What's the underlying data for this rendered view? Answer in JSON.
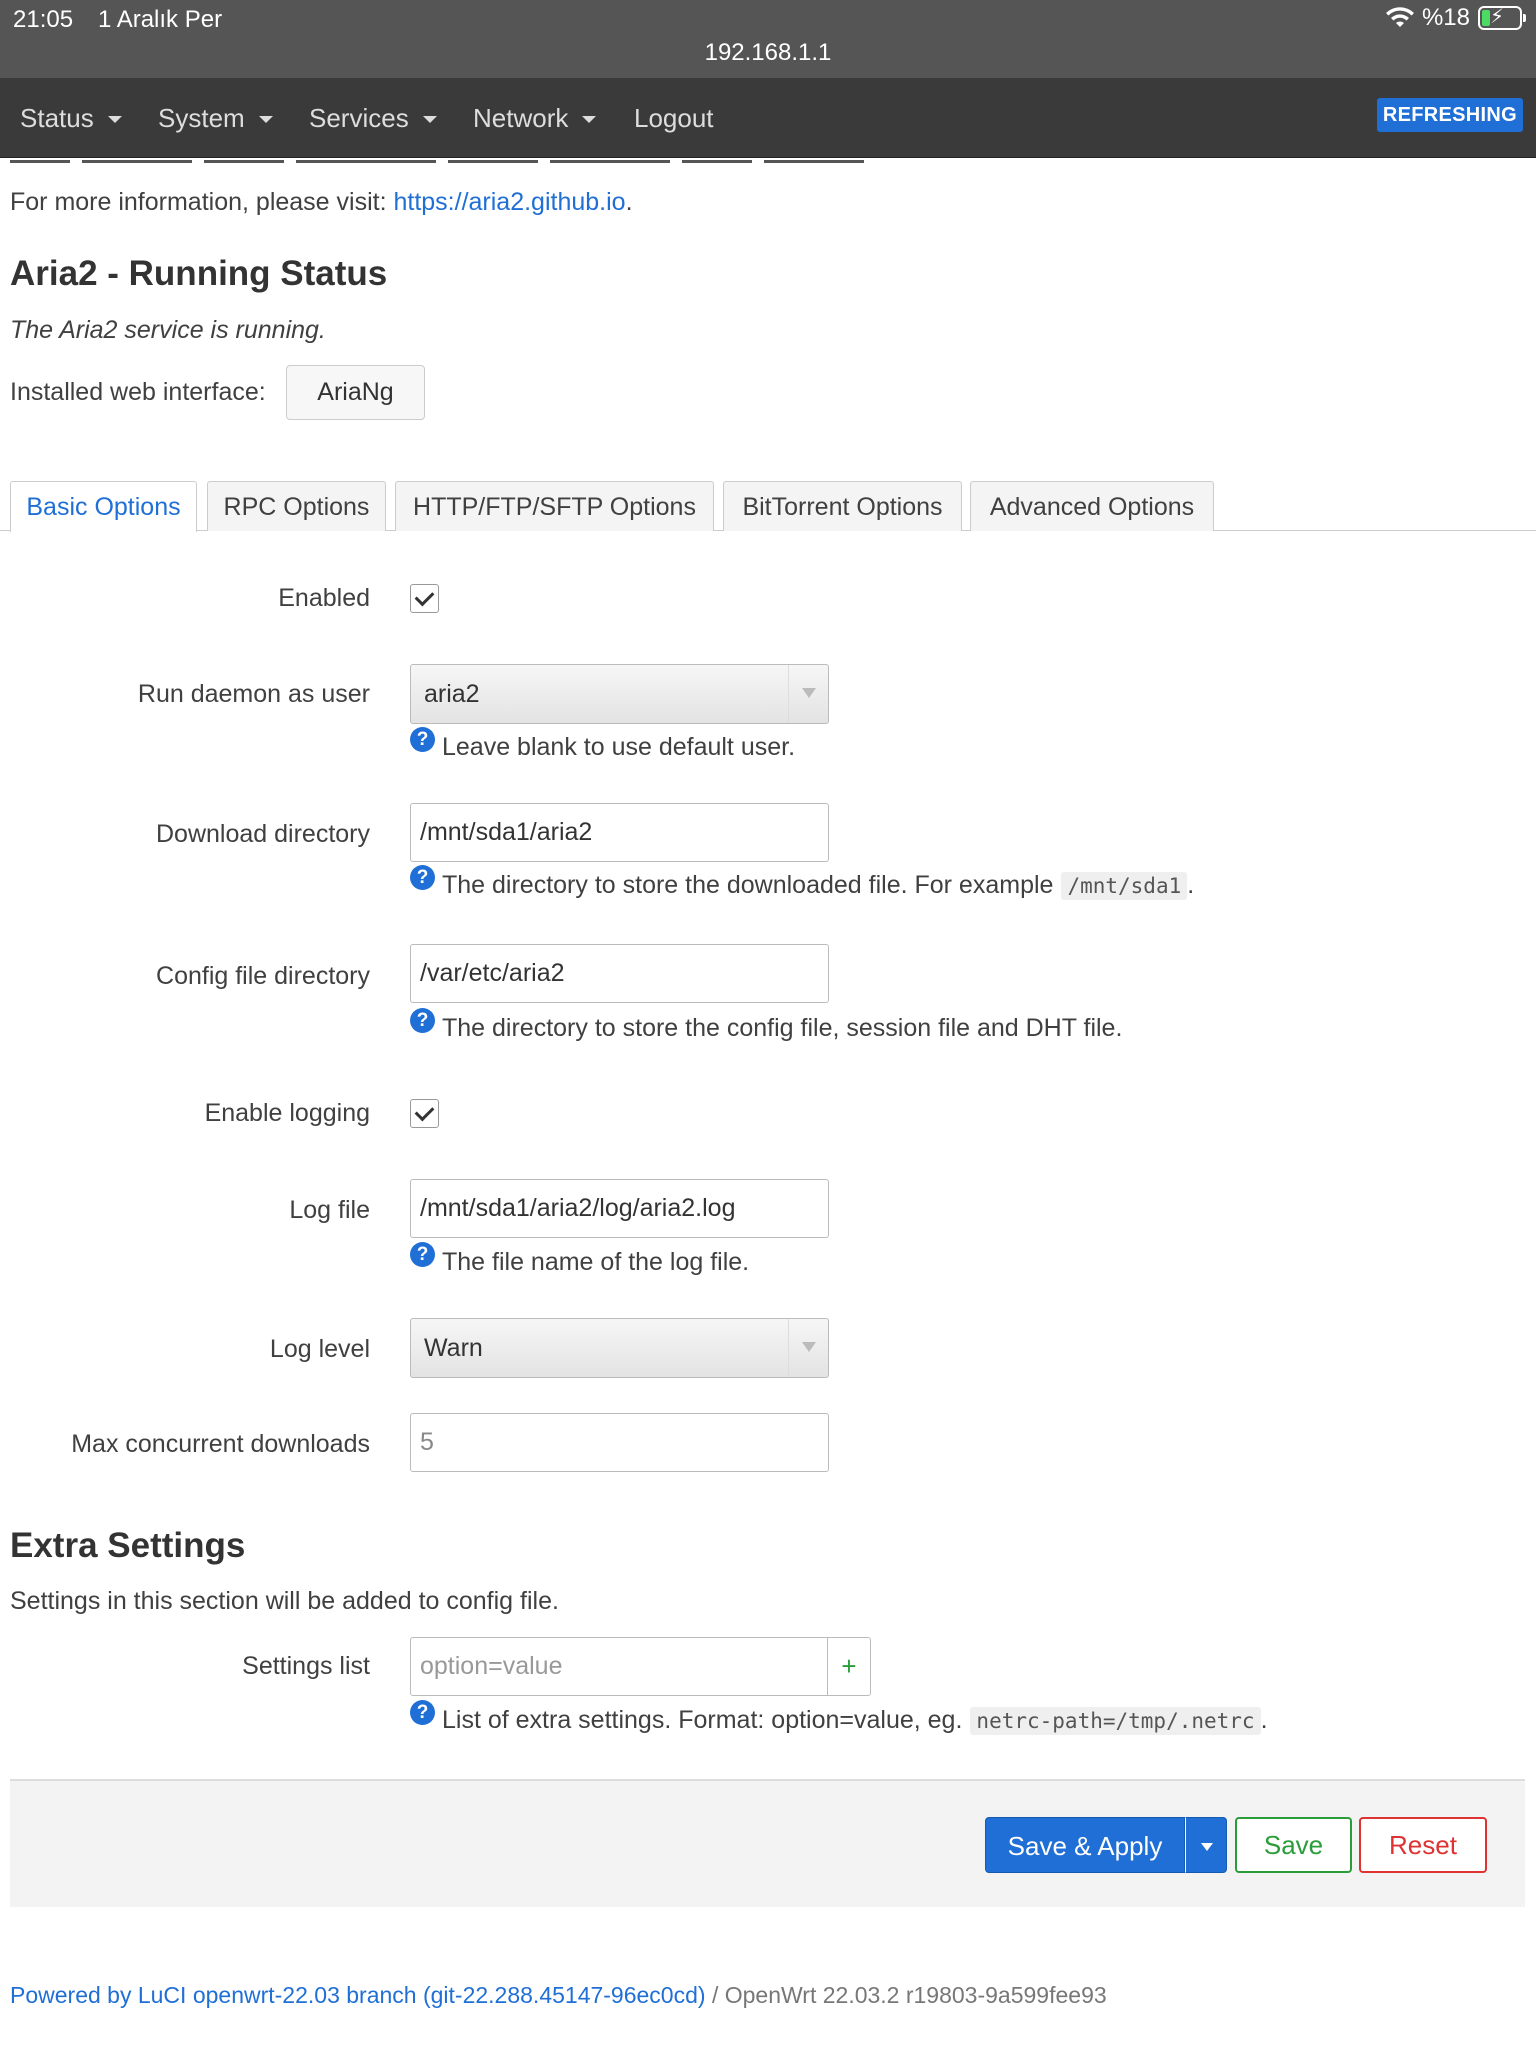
{
  "statusbar": {
    "time": "21:05",
    "date": "1 Aralık Per",
    "url": "192.168.1.1",
    "battery": "%18"
  },
  "nav": {
    "items": [
      "Status",
      "System",
      "Services",
      "Network",
      "Logout"
    ],
    "refreshing": "REFRESHING"
  },
  "intro": {
    "more_info": "For more information, please visit:",
    "link": "https://aria2.github.io",
    "period": "."
  },
  "status": {
    "title": "Aria2 - Running Status",
    "running": "The Aria2 service is running.",
    "web_label": "Installed web interface:",
    "web_button": "AriaNg"
  },
  "tabs": [
    "Basic Options",
    "RPC Options",
    "HTTP/FTP/SFTP Options",
    "BitTorrent Options",
    "Advanced Options"
  ],
  "form": {
    "enabled": {
      "label": "Enabled",
      "checked": true
    },
    "user": {
      "label": "Run daemon as user",
      "value": "aria2",
      "help": "Leave blank to use default user."
    },
    "download_dir": {
      "label": "Download directory",
      "value": "/mnt/sda1/aria2",
      "help": "The directory to store the downloaded file. For example",
      "code": "/mnt/sda1",
      "tail": "."
    },
    "config_dir": {
      "label": "Config file directory",
      "value": "/var/etc/aria2",
      "help": "The directory to store the config file, session file and DHT file."
    },
    "logging": {
      "label": "Enable logging",
      "checked": true
    },
    "log_file": {
      "label": "Log file",
      "value": "/mnt/sda1/aria2/log/aria2.log",
      "help": "The file name of the log file."
    },
    "log_level": {
      "label": "Log level",
      "value": "Warn"
    },
    "max_downloads": {
      "label": "Max concurrent downloads",
      "value": "5"
    }
  },
  "extra": {
    "title": "Extra Settings",
    "desc": "Settings in this section will be added to config file.",
    "list_label": "Settings list",
    "placeholder": "option=value",
    "add": "+",
    "help": "List of extra settings. Format: option=value, eg.",
    "code": "netrc-path=/tmp/.netrc",
    "tail": "."
  },
  "actions": {
    "apply": "Save & Apply",
    "save": "Save",
    "reset": "Reset"
  },
  "footer": {
    "powered": "Powered by LuCI openwrt-22.03 branch (git-22.288.45147-96ec0cd)",
    "sep": " / ",
    "version": "OpenWrt 22.03.2 r19803-9a599fee93"
  },
  "colors": {
    "accent": "#1f6fd6",
    "save": "#2a9d3a",
    "reset": "#dd3333",
    "nav_bg": "#3a3a3a"
  }
}
